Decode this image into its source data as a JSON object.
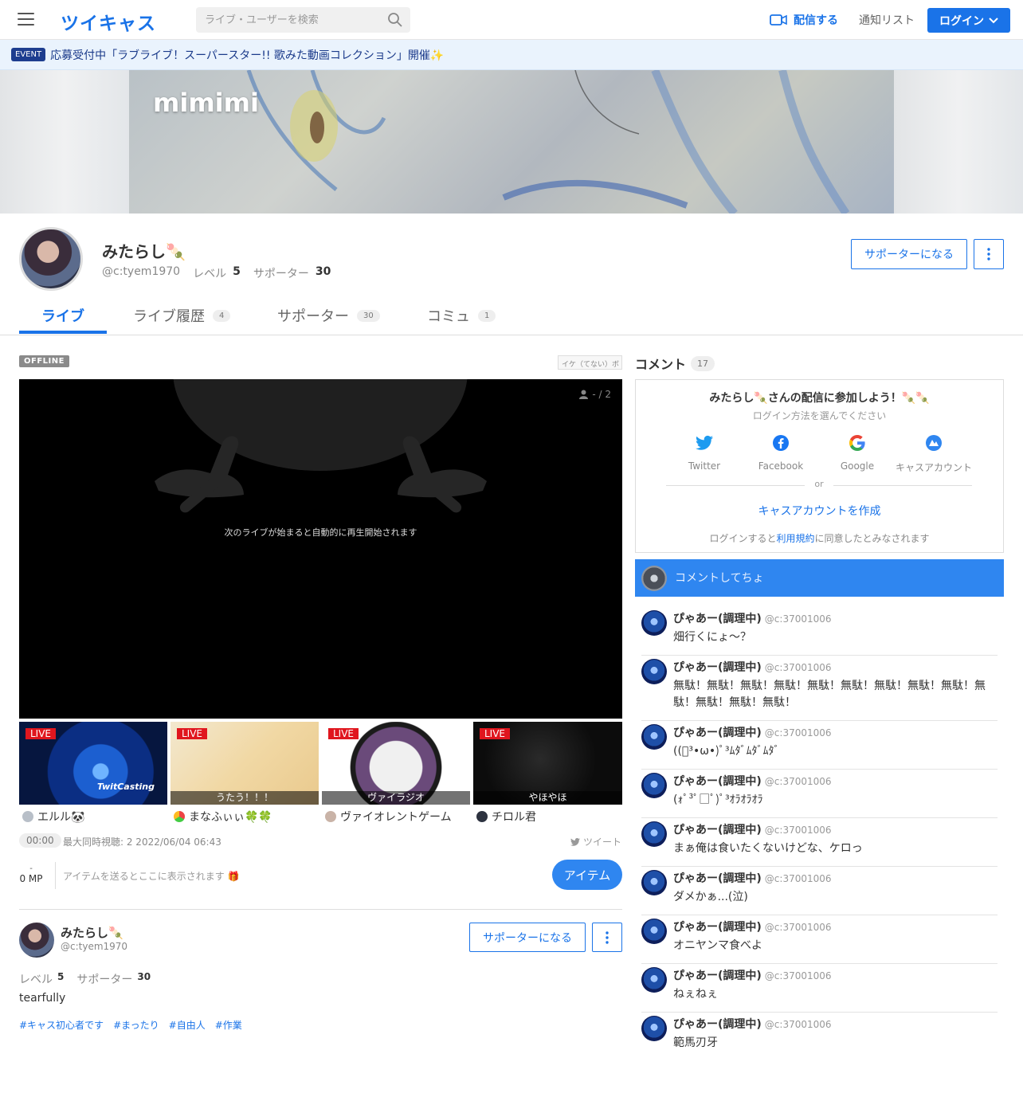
{
  "header": {
    "logo": "ツイキャス",
    "search_placeholder": "ライブ・ユーザーを検索",
    "broadcast_label": "配信する",
    "notify_label": "通知リスト",
    "login_label": "ログイン"
  },
  "event": {
    "badge": "EVENT",
    "text": "応募受付中「ラブライブ！スーパースター!! 歌みた動画コレクション」開催✨"
  },
  "banner": {
    "title": "mimimi"
  },
  "profile": {
    "name": "みたらし🍡",
    "id": "@c:tyem1970",
    "level_label": "レベル",
    "level": "5",
    "supporter_label": "サポーター",
    "supporters": "30",
    "support_button": "サポーターになる",
    "bio": "tearfully",
    "tags": [
      "#キャス初心者です",
      "#まったり",
      "#自由人",
      "#作業"
    ]
  },
  "tabs": [
    {
      "label": "ライブ",
      "count": ""
    },
    {
      "label": "ライブ履歴",
      "count": "4"
    },
    {
      "label": "サポーター",
      "count": "30"
    },
    {
      "label": "コミュ",
      "count": "1"
    }
  ],
  "player": {
    "status": "OFFLINE",
    "hashtag": "イケ（てない）ボ",
    "viewers": "- / 2",
    "message": "次のライブが始まると自動的に再生開始されます"
  },
  "recommend": [
    {
      "live": "LIVE",
      "caption": "",
      "user": "エルル🐼"
    },
    {
      "live": "LIVE",
      "caption": "うたう！！！",
      "user": "まなふぃぃ🍀🍀"
    },
    {
      "live": "LIVE",
      "caption": "ヴァイラジオ",
      "user": "ヴァイオレントゲーム"
    },
    {
      "live": "LIVE",
      "caption": "やほやほ",
      "user": "チロル君"
    }
  ],
  "thumb_brand": "TwitCasting",
  "stats": {
    "time": "00:00",
    "info": "最大同時視聴: 2  2022/06/04 06:43",
    "tweet": "ツイート"
  },
  "item": {
    "mp_dash": "-",
    "mp": "0 MP",
    "hint": "アイテムを送るとここに表示されます 🎁",
    "button": "アイテム"
  },
  "comments_panel": {
    "title": "コメント",
    "count": "17",
    "login_title": "みたらし🍡さんの配信に参加しよう！🍡🍡",
    "login_sub": "ログイン方法を選んでください",
    "providers": [
      "Twitter",
      "Facebook",
      "Google",
      "キャスアカウント"
    ],
    "or": "or",
    "create": "キャスアカウントを作成",
    "terms_pre": "ログインすると",
    "terms_link": "利用規約",
    "terms_post": "に同意したとみなされます",
    "input_placeholder": "コメントしてちょ"
  },
  "comments": [
    {
      "name": "ぴゃあー(調理中)",
      "id": "@c:37001006",
      "text": "畑行くにょ〜？"
    },
    {
      "name": "ぴゃあー(調理中)",
      "id": "@c:37001006",
      "text": "無駄！無駄！無駄！無駄！無駄！無駄！無駄！無駄！無駄！無駄！無駄！無駄！無駄！"
    },
    {
      "name": "ぴゃあー(調理中)",
      "id": "@c:37001006",
      "text": "((ﾟ³•ω•)ﾟ³ﾑﾀﾞﾑﾀﾞﾑﾀﾞ"
    },
    {
      "name": "ぴゃあー(調理中)",
      "id": "@c:37001006",
      "text": "(ｫﾟ³ﾟ□ﾟ)ﾟ³ｵﾗｵﾗｵﾗ"
    },
    {
      "name": "ぴゃあー(調理中)",
      "id": "@c:37001006",
      "text": "まぁ俺は食いたくないけどな、ケロっ"
    },
    {
      "name": "ぴゃあー(調理中)",
      "id": "@c:37001006",
      "text": "ダメかぁ...(泣)"
    },
    {
      "name": "ぴゃあー(調理中)",
      "id": "@c:37001006",
      "text": "オニヤンマ食べよ"
    },
    {
      "name": "ぴゃあー(調理中)",
      "id": "@c:37001006",
      "text": "ねぇねぇ"
    },
    {
      "name": "ぴゃあー(調理中)",
      "id": "@c:37001006",
      "text": "範馬刃牙"
    }
  ]
}
